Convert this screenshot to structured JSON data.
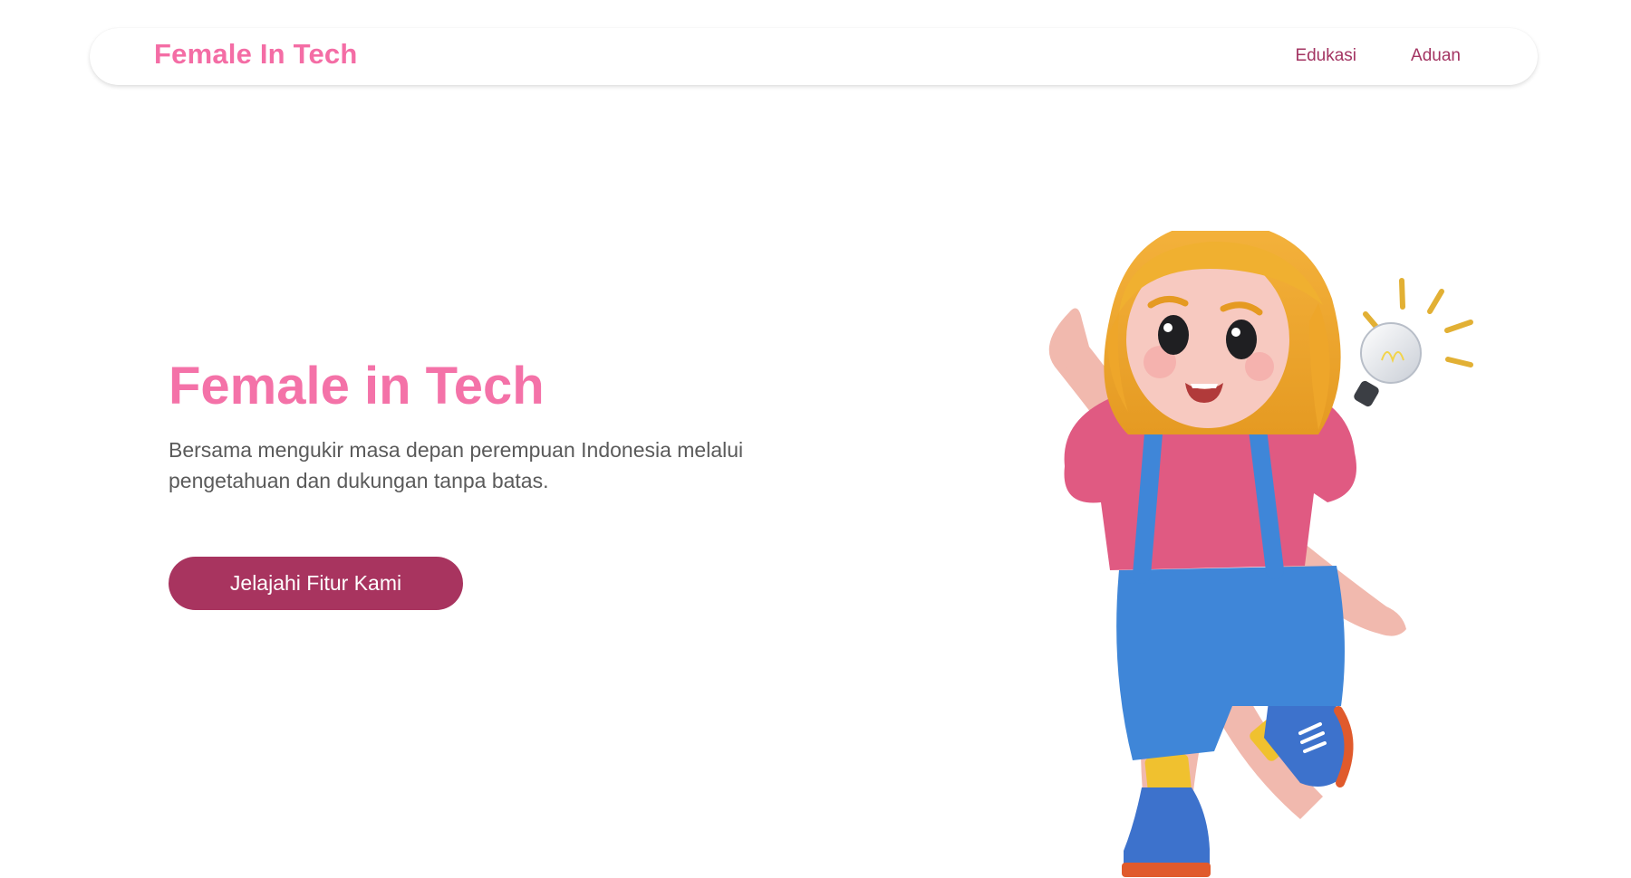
{
  "nav": {
    "brand": "Female In Tech",
    "links": [
      {
        "label": "Edukasi"
      },
      {
        "label": "Aduan"
      }
    ]
  },
  "hero": {
    "title": "Female in Tech",
    "subtitle": "Bersama mengukir masa depan perempuan Indonesia melalui pengetahuan dan dukungan tanpa batas.",
    "cta_label": "Jelajahi Fitur Kami",
    "illustration": "3d-girl-character-pointing-up-with-lightbulb"
  },
  "colors": {
    "brand_pink": "#f46da5",
    "title_pink": "#f472a8",
    "nav_link": "#a33462",
    "cta_background": "#a8345f",
    "subtitle_text": "#5a5a5a"
  }
}
